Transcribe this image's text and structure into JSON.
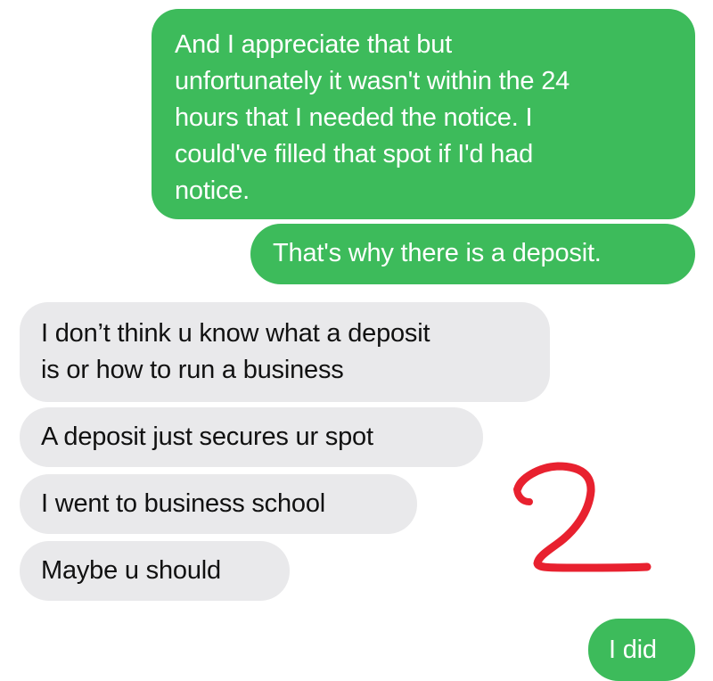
{
  "conversation": {
    "messages": [
      {
        "direction": "sent",
        "lines": [
          "And I appreciate that but",
          "unfortunately it wasn't within the 24",
          "hours that I needed the notice. I",
          "could've filled that spot if I'd had",
          "notice."
        ]
      },
      {
        "direction": "sent",
        "lines": [
          "That's why there is a deposit."
        ]
      },
      {
        "direction": "received",
        "lines": [
          "I don’t think u know what a deposit",
          "is or how to run a business"
        ]
      },
      {
        "direction": "received",
        "lines": [
          "A deposit just secures ur spot"
        ]
      },
      {
        "direction": "received",
        "lines": [
          "I went to business school"
        ]
      },
      {
        "direction": "received",
        "lines": [
          "Maybe u should"
        ]
      },
      {
        "direction": "sent",
        "lines": [
          "I did"
        ]
      }
    ]
  },
  "annotation": {
    "text": "2",
    "color": "#e8212f"
  },
  "colors": {
    "sent_bubble": "#3dbb5b",
    "received_bubble": "#e9e9eb",
    "sent_text": "#ffffff",
    "received_text": "#111111"
  }
}
